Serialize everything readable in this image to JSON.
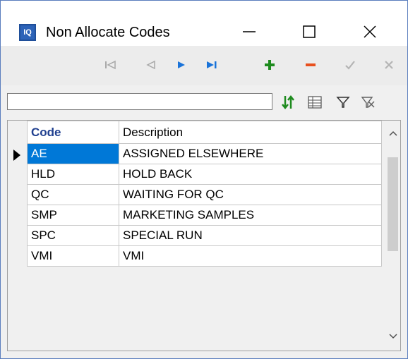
{
  "window": {
    "title": "Non Allocate Codes",
    "icon_text": "IQ",
    "controls": [
      "minimize-icon",
      "maximize-icon",
      "close-icon"
    ]
  },
  "navigator": {
    "buttons": [
      "first-record-icon",
      "prior-record-icon",
      "next-record-icon",
      "last-record-icon",
      "insert-icon",
      "delete-icon",
      "post-icon",
      "cancel-icon"
    ]
  },
  "search": {
    "value": "",
    "placeholder": ""
  },
  "toolbar": {
    "buttons": [
      "sort-icon",
      "columns-icon",
      "filter-icon",
      "clear-filter-icon"
    ]
  },
  "grid": {
    "columns": [
      "Code",
      "Description"
    ],
    "rows": [
      {
        "code": "AE",
        "description": "ASSIGNED ELSEWHERE"
      },
      {
        "code": "HLD",
        "description": "HOLD BACK"
      },
      {
        "code": "QC",
        "description": "WAITING FOR QC"
      },
      {
        "code": "SMP",
        "description": "MARKETING SAMPLES"
      },
      {
        "code": "SPC",
        "description": "SPECIAL RUN"
      },
      {
        "code": "VMI",
        "description": "VMI"
      }
    ],
    "selected_row": 0
  },
  "colors": {
    "accent": "#0078d7",
    "header_code": "#1f3f8f",
    "insert_green": "#1e8b1e",
    "delete_orange": "#e8501e",
    "nav_blue": "#1a73d9"
  }
}
